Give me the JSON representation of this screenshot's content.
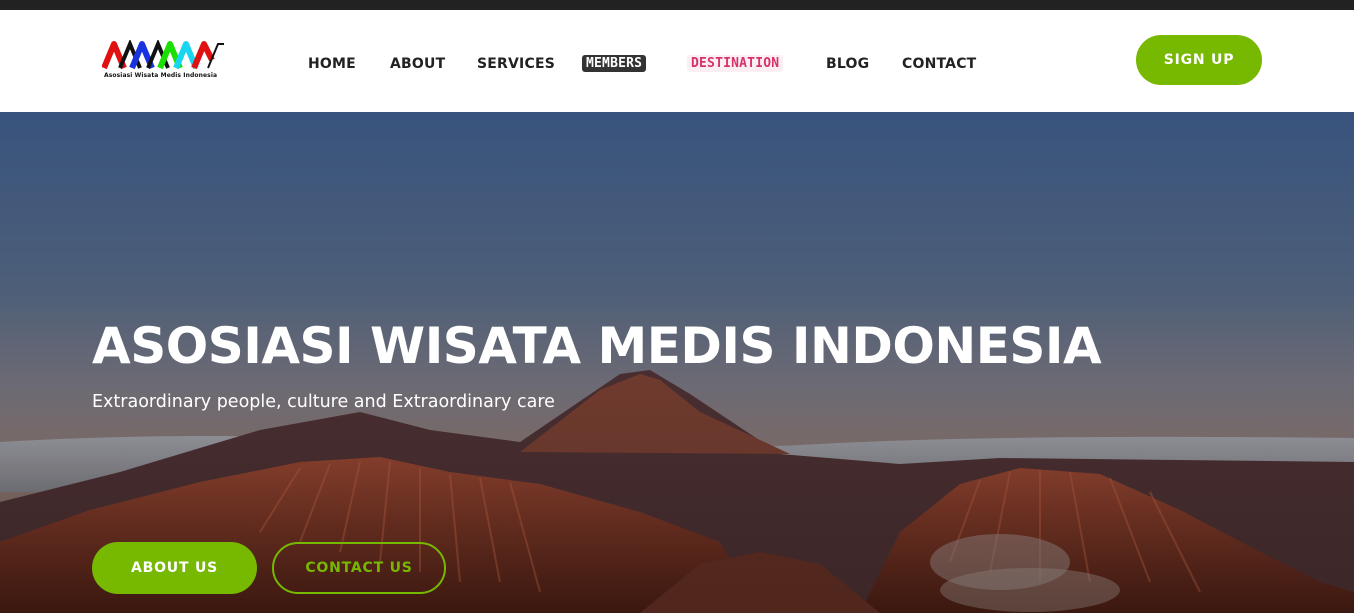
{
  "header": {
    "logo_text": "Asosiasi Wisata Medis Indonesia",
    "signup_label": "SIGN UP"
  },
  "nav": {
    "items": [
      {
        "label": "HOME"
      },
      {
        "label": "ABOUT"
      },
      {
        "label": "SERVICES"
      },
      {
        "label": "MEMBERS"
      },
      {
        "label": "DESTINATION"
      },
      {
        "label": "BLOG"
      },
      {
        "label": "CONTACT"
      }
    ]
  },
  "hero": {
    "title": "ASOSIASI WISATA MEDIS INDONESIA",
    "subtitle": "Extraordinary people, culture and Extraordinary care",
    "about_label": "ABOUT US",
    "contact_label": "CONTACT US"
  },
  "colors": {
    "accent": "#76b900",
    "topbar": "#222222",
    "nav_text": "#222222",
    "destination_text": "#d6336c"
  },
  "icons": {
    "logo": "awmi-wave-logo"
  }
}
